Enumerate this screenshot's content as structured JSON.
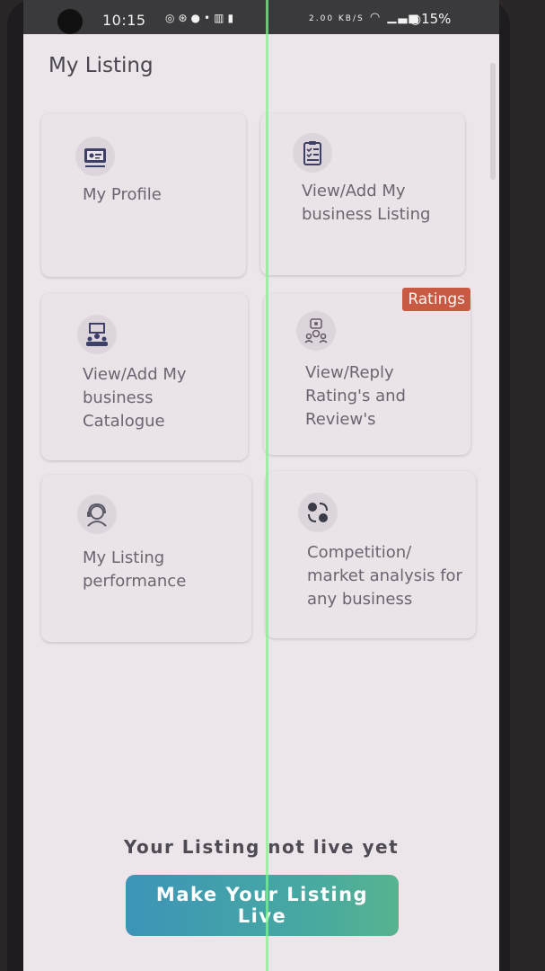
{
  "status_bar": {
    "time": "10:15",
    "icons": [
      "whatsapp-icon",
      "app-icon",
      "chat-icon",
      "dot-icon",
      "nfc-icon",
      "vibrate-icon"
    ],
    "speed": "2.00 KB/S",
    "battery": "15%"
  },
  "header": {
    "title": "My Listing"
  },
  "cards": [
    {
      "label": "My Profile",
      "icon": "dashboard-icon"
    },
    {
      "label": "View/Add My business Listing",
      "icon": "checklist-icon"
    },
    {
      "label": "View/Add My business Catalogue",
      "icon": "presentation-icon"
    },
    {
      "label": "View/Reply Rating's and Review's",
      "icon": "review-icon",
      "badge": "Ratings"
    },
    {
      "label": "My Listing performance",
      "icon": "support-icon"
    },
    {
      "label": "Competition/ market analysis for any business",
      "icon": "competition-icon"
    }
  ],
  "footer": {
    "status_text": "Your Listing not live yet",
    "button_label": "Make Your Listing Live"
  },
  "colors": {
    "background": "#ece6ea",
    "badge": "#c85a43",
    "button_start": "#3c94b8",
    "button_end": "#57b38e"
  }
}
